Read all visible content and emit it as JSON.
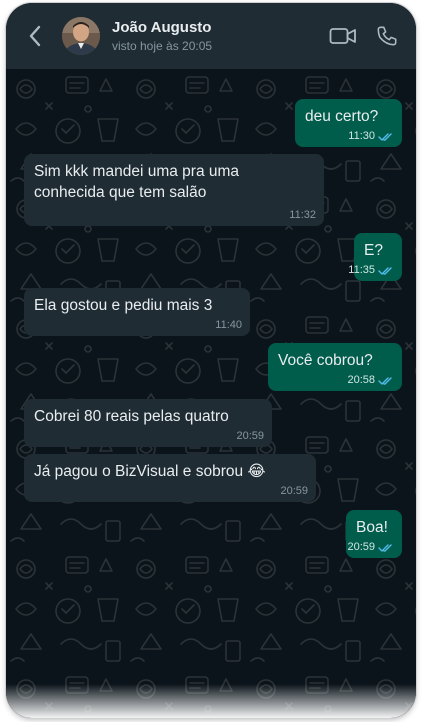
{
  "header": {
    "contact_name": "João Augusto",
    "contact_status": "visto hoje às 20:05",
    "back_icon": "chevron-left-icon",
    "video_icon": "video-camera-icon",
    "call_icon": "phone-icon"
  },
  "messages": [
    {
      "direction": "out",
      "text": "deu certo?",
      "time": "11:30",
      "read": true
    },
    {
      "direction": "in",
      "text": "Sim kkk mandei uma pra uma\nconhecida que tem salão",
      "time": "11:32"
    },
    {
      "direction": "out",
      "text": "E?",
      "time": "11:35",
      "read": true
    },
    {
      "direction": "in",
      "text": "Ela gostou e pediu mais 3",
      "time": "11:40"
    },
    {
      "direction": "out",
      "text": "Você cobrou?",
      "time": "20:58",
      "read": true
    },
    {
      "direction": "in",
      "text": "Cobrei 80 reais pelas quatro",
      "time": "20:59"
    },
    {
      "direction": "in",
      "text": "Já pagou o BizVisual e sobrou 😂",
      "time": "20:59"
    },
    {
      "direction": "out",
      "text": "Boa!",
      "time": "20:59",
      "read": true
    }
  ],
  "colors": {
    "header_bg": "#1f2c34",
    "chat_bg": "#0b141a",
    "incoming_bubble": "#1f2c34",
    "outgoing_bubble": "#005c4b",
    "read_tick": "#53bdeb"
  }
}
